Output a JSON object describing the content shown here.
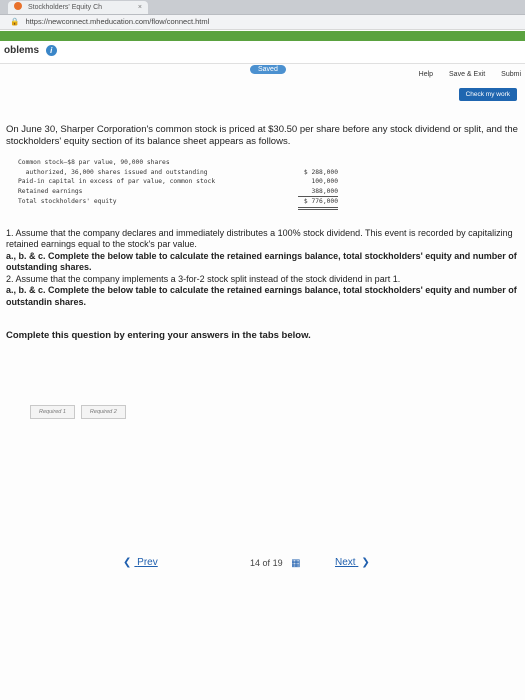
{
  "browser": {
    "tab_title": "Stockholders' Equity Ch",
    "tab_close": "×",
    "url": "https://newconnect.mheducation.com/flow/connect.html"
  },
  "header": {
    "title": "oblems",
    "info": "i",
    "saved": "Saved",
    "help": "Help",
    "save_exit": "Save & Exit",
    "submit": "Submi",
    "check_work": "Check my work"
  },
  "problem": {
    "intro": "On June 30, Sharper Corporation's common stock is priced at $30.50 per share before any stock dividend or split, and the stockholders' equity section of its balance sheet appears as follows.",
    "statement": [
      {
        "label": "Common stock—$8 par value, 90,000 shares",
        "amount": ""
      },
      {
        "label": "  authorized, 36,000 shares issued and outstanding",
        "amount": "$ 288,000"
      },
      {
        "label": "Paid-in capital in excess of par value, common stock",
        "amount": "100,000"
      },
      {
        "label": "Retained earnings",
        "amount": "388,000"
      },
      {
        "label": "Total stockholders' equity",
        "amount": "$ 776,000"
      }
    ],
    "q1": "1. Assume that the company declares and immediately distributes a 100% stock dividend. This event is recorded by capitalizing retained earnings equal to the stock's par value.",
    "q1abc": "a., b. & c. Complete the below table to calculate the retained earnings balance, total stockholders' equity and number of outstanding shares.",
    "q2": "2. Assume that the company implements a 3-for-2 stock split instead of the stock dividend in part 1.",
    "q2abc": "a., b. & c. Complete the below table to calculate the retained earnings balance, total stockholders' equity and number of outstandin shares.",
    "complete": "Complete this question by entering your answers in the tabs below.",
    "answer_tabs": [
      "Required 1",
      "Required 2"
    ]
  },
  "nav": {
    "prev": "Prev",
    "page_current": "14",
    "page_of": "of",
    "page_total": "19",
    "next": "Next"
  }
}
